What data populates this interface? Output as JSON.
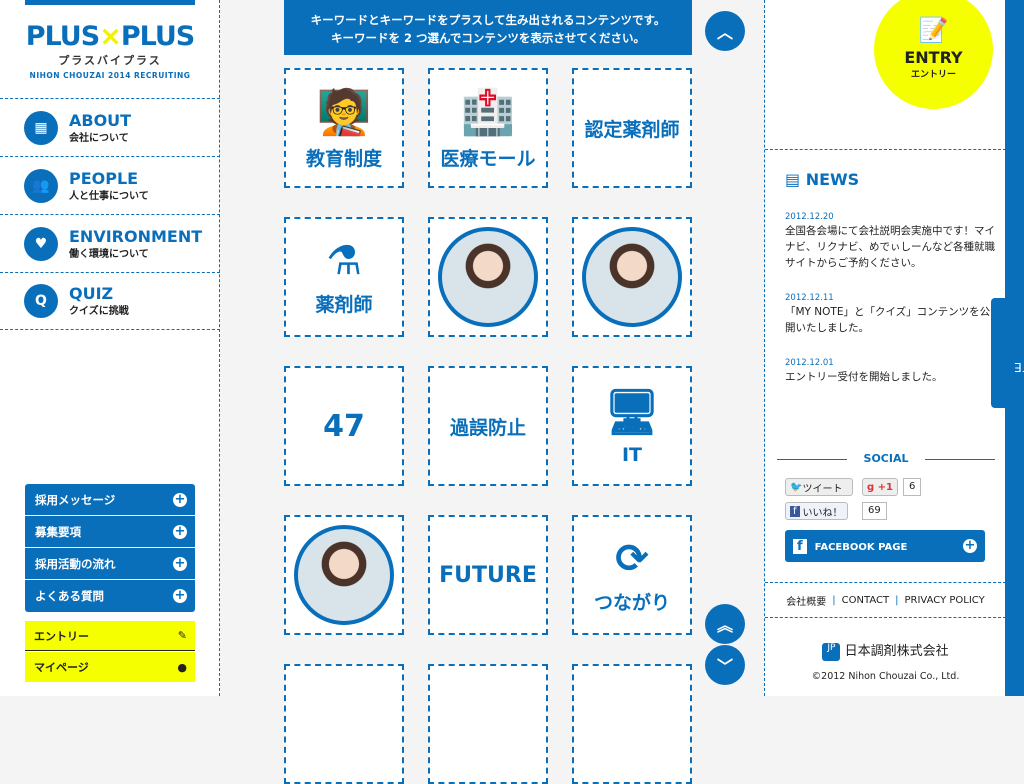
{
  "logo": {
    "main_left": "PLUS",
    "cross": "×",
    "main_right": "PLUS",
    "kana": "プラスバイプラス",
    "sub": "NIHON CHOUZAI 2014 RECRUITING"
  },
  "nav": [
    {
      "en": "ABOUT",
      "jp": "会社について",
      "icon": "building-icon"
    },
    {
      "en": "PEOPLE",
      "jp": "人と仕事について",
      "icon": "people-icon"
    },
    {
      "en": "ENVIRONMENT",
      "jp": "働く環境について",
      "icon": "heart-icon"
    },
    {
      "en": "QUIZ",
      "jp": "クイズに挑戦",
      "icon": "q-icon"
    }
  ],
  "menu": [
    "採用メッセージ",
    "募集要項",
    "採用活動の流れ",
    "よくある質問"
  ],
  "entry_btn": "エントリー",
  "mypage_btn": "マイページ",
  "intro": {
    "line1": "キーワードとキーワードをプラスして生み出されるコンテンツです。",
    "line2": "キーワードを 2 つ選んでコンテンツを表示させてください。"
  },
  "keywords": {
    "k1": "教育制度",
    "k2": "医療モール",
    "k3": "認定薬剤師",
    "k4": "薬剤師",
    "k7": "47",
    "k8": "過誤防止",
    "k9": "IT",
    "k11": "FUTURE",
    "k12": "つながり"
  },
  "entry": {
    "en": "ENTRY",
    "jp": "エントリー"
  },
  "news": {
    "title": "NEWS",
    "items": [
      {
        "date": "2012.12.20",
        "text": "全国各会場にて会社説明会実施中です！マイナビ、リクナビ、めでぃしーんなど各種就職サイトからご予約ください。"
      },
      {
        "date": "2012.12.11",
        "text": "「MY NOTE」と「クイズ」コンテンツを公開いたしました。"
      },
      {
        "date": "2012.12.01",
        "text": "エントリー受付を開始しました。"
      }
    ]
  },
  "mynote": "MY NOTE",
  "social": {
    "title": "SOCIAL",
    "tweet": "ツイート",
    "gplus": "+1",
    "gplus_count": "6",
    "like": "いいね！",
    "like_count": "69",
    "fb_page": "FACEBOOK PAGE"
  },
  "footer": {
    "links": [
      "会社概要",
      "CONTACT",
      "PRIVACY POLICY"
    ],
    "sep": "|",
    "corp": "日本調剤株式会社",
    "copyright": "©2012 Nihon Chouzai Co., Ltd."
  },
  "colors": {
    "brand": "#0a6fbb",
    "accent": "#f5ff00"
  }
}
